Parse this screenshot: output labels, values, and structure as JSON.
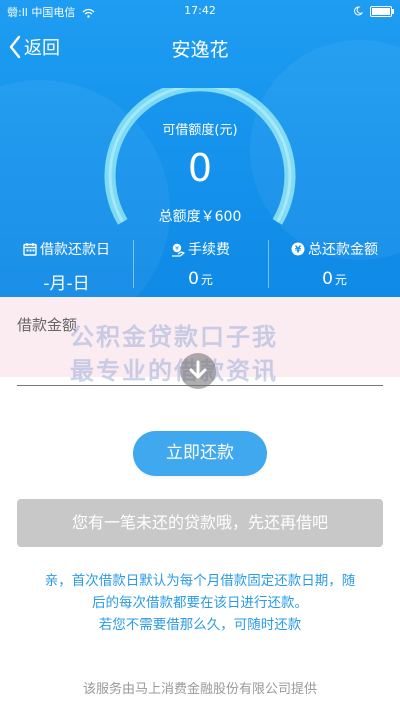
{
  "status_bar": {
    "left_text": "䎕:ll 中国电信",
    "time": "17:42"
  },
  "nav": {
    "back_label": "返回",
    "title": "安逸花"
  },
  "gauge": {
    "label": "可借额度(元)",
    "value": "0",
    "total_label": "总额度￥600",
    "progress": 0
  },
  "stats": [
    {
      "label": "借款还款日",
      "value": "-月-日",
      "unit": "",
      "icon": "calendar-icon"
    },
    {
      "label": "手续费",
      "value": "0",
      "unit": "元",
      "icon": "fee-icon"
    },
    {
      "label": "总还款金额",
      "value": "0",
      "unit": "元",
      "icon": "yen-coin-icon"
    }
  ],
  "amount": {
    "label": "借款金额"
  },
  "watermark": {
    "line1": "公积金贷款口子我",
    "line2": "最专业的借款资讯"
  },
  "actions": {
    "repay_label": "立即还款"
  },
  "notice": "您有一笔未还的贷款哦，先还再借吧",
  "tips": {
    "line1": "亲，首次借款日默认为每个月借款固定还款日期，随",
    "line2": "后的每次借款都要在该日进行还款。",
    "line3": "若您不需要借那么久，可随时还款"
  },
  "footer": "该服务由马上消费金融股份有限公司提供",
  "colors": {
    "primary": "#1492ec",
    "button": "#3fa8ef",
    "tip_text": "#2a9be6",
    "disabled": "#c8c8c8"
  }
}
